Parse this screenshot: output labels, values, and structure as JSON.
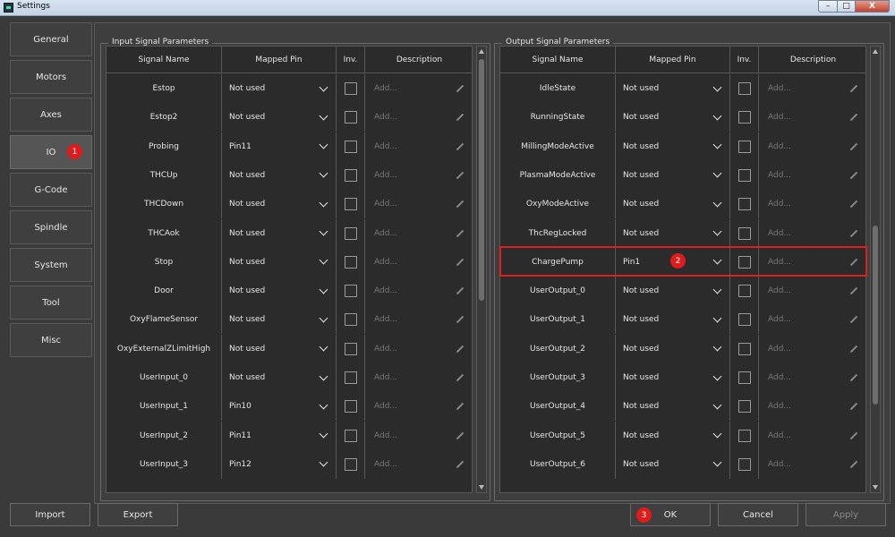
{
  "window": {
    "title": "Settings",
    "minimize": "–",
    "maximize": "□",
    "close": "X"
  },
  "nav": {
    "items": [
      {
        "label": "General"
      },
      {
        "label": "Motors"
      },
      {
        "label": "Axes"
      },
      {
        "label": "IO"
      },
      {
        "label": "G-Code"
      },
      {
        "label": "Spindle"
      },
      {
        "label": "System"
      },
      {
        "label": "Tool"
      },
      {
        "label": "Misc"
      }
    ],
    "active": "IO"
  },
  "headers": {
    "name": "Signal Name",
    "pin": "Mapped Pin",
    "inv": "Inv.",
    "desc": "Description"
  },
  "input": {
    "title": "Input Signal Parameters",
    "rows": [
      {
        "name": "Estop",
        "pin": "Not used",
        "desc": "Add..."
      },
      {
        "name": "Estop2",
        "pin": "Not used",
        "desc": "Add..."
      },
      {
        "name": "Probing",
        "pin": "Pin11",
        "desc": "Add..."
      },
      {
        "name": "THCUp",
        "pin": "Not used",
        "desc": "Add..."
      },
      {
        "name": "THCDown",
        "pin": "Not used",
        "desc": "Add..."
      },
      {
        "name": "THCAok",
        "pin": "Not used",
        "desc": "Add..."
      },
      {
        "name": "Stop",
        "pin": "Not used",
        "desc": "Add..."
      },
      {
        "name": "Door",
        "pin": "Not used",
        "desc": "Add..."
      },
      {
        "name": "OxyFlameSensor",
        "pin": "Not used",
        "desc": "Add..."
      },
      {
        "name": "OxyExternalZLimitHigh",
        "pin": "Not used",
        "desc": "Add..."
      },
      {
        "name": "UserInput_0",
        "pin": "Not used",
        "desc": "Add..."
      },
      {
        "name": "UserInput_1",
        "pin": "Pin10",
        "desc": "Add..."
      },
      {
        "name": "UserInput_2",
        "pin": "Pin11",
        "desc": "Add..."
      },
      {
        "name": "UserInput_3",
        "pin": "Pin12",
        "desc": "Add..."
      }
    ]
  },
  "output": {
    "title": "Output Signal Parameters",
    "rows": [
      {
        "name": "IdleState",
        "pin": "Not used",
        "desc": "Add..."
      },
      {
        "name": "RunningState",
        "pin": "Not used",
        "desc": "Add..."
      },
      {
        "name": "MillingModeActive",
        "pin": "Not used",
        "desc": "Add..."
      },
      {
        "name": "PlasmaModeActive",
        "pin": "Not used",
        "desc": "Add..."
      },
      {
        "name": "OxyModeActive",
        "pin": "Not used",
        "desc": "Add..."
      },
      {
        "name": "ThcRegLocked",
        "pin": "Not used",
        "desc": "Add..."
      },
      {
        "name": "ChargePump",
        "pin": "Pin1",
        "desc": "Add...",
        "highlighted": true
      },
      {
        "name": "UserOutput_0",
        "pin": "Not used",
        "desc": "Add..."
      },
      {
        "name": "UserOutput_1",
        "pin": "Not used",
        "desc": "Add..."
      },
      {
        "name": "UserOutput_2",
        "pin": "Not used",
        "desc": "Add..."
      },
      {
        "name": "UserOutput_3",
        "pin": "Not used",
        "desc": "Add..."
      },
      {
        "name": "UserOutput_4",
        "pin": "Not used",
        "desc": "Add..."
      },
      {
        "name": "UserOutput_5",
        "pin": "Not used",
        "desc": "Add..."
      },
      {
        "name": "UserOutput_6",
        "pin": "Not used",
        "desc": "Add..."
      }
    ]
  },
  "badges": {
    "b1": "1",
    "b2": "2",
    "b3": "3"
  },
  "buttons": {
    "import": "Import",
    "export": "Export",
    "ok": "OK",
    "cancel": "Cancel",
    "apply": "Apply"
  },
  "colors": {
    "highlight": "#e02020",
    "badge": "#e01b1b",
    "panel": "#2b2b2b"
  }
}
